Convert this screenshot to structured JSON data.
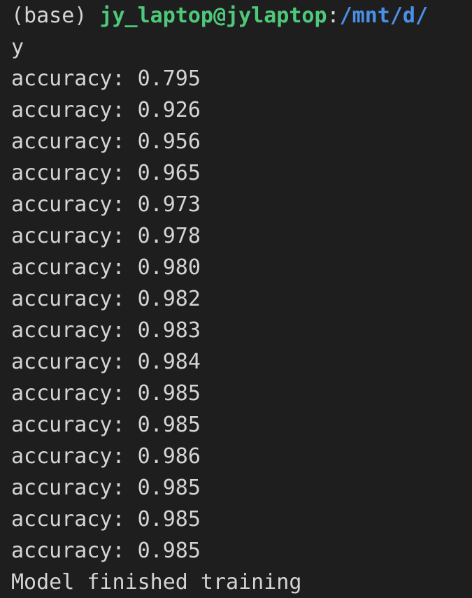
{
  "terminal": {
    "prompt": {
      "env": "(base) ",
      "user_host": "jy_laptop@jylaptop",
      "separator": ":",
      "path": "/mnt/d/"
    },
    "wrapped_line": "y",
    "output_lines": [
      "accuracy: 0.795",
      "accuracy: 0.926",
      "accuracy: 0.956",
      "accuracy: 0.965",
      "accuracy: 0.973",
      "accuracy: 0.978",
      "accuracy: 0.980",
      "accuracy: 0.982",
      "accuracy: 0.983",
      "accuracy: 0.984",
      "accuracy: 0.985",
      "accuracy: 0.985",
      "accuracy: 0.986",
      "accuracy: 0.985",
      "accuracy: 0.985",
      "accuracy: 0.985"
    ],
    "final_message": "Model finished training"
  },
  "colors": {
    "background": "#1e1e1e",
    "text": "#d4d4d4",
    "user_host": "#4ec97b",
    "path": "#4a90e8"
  }
}
